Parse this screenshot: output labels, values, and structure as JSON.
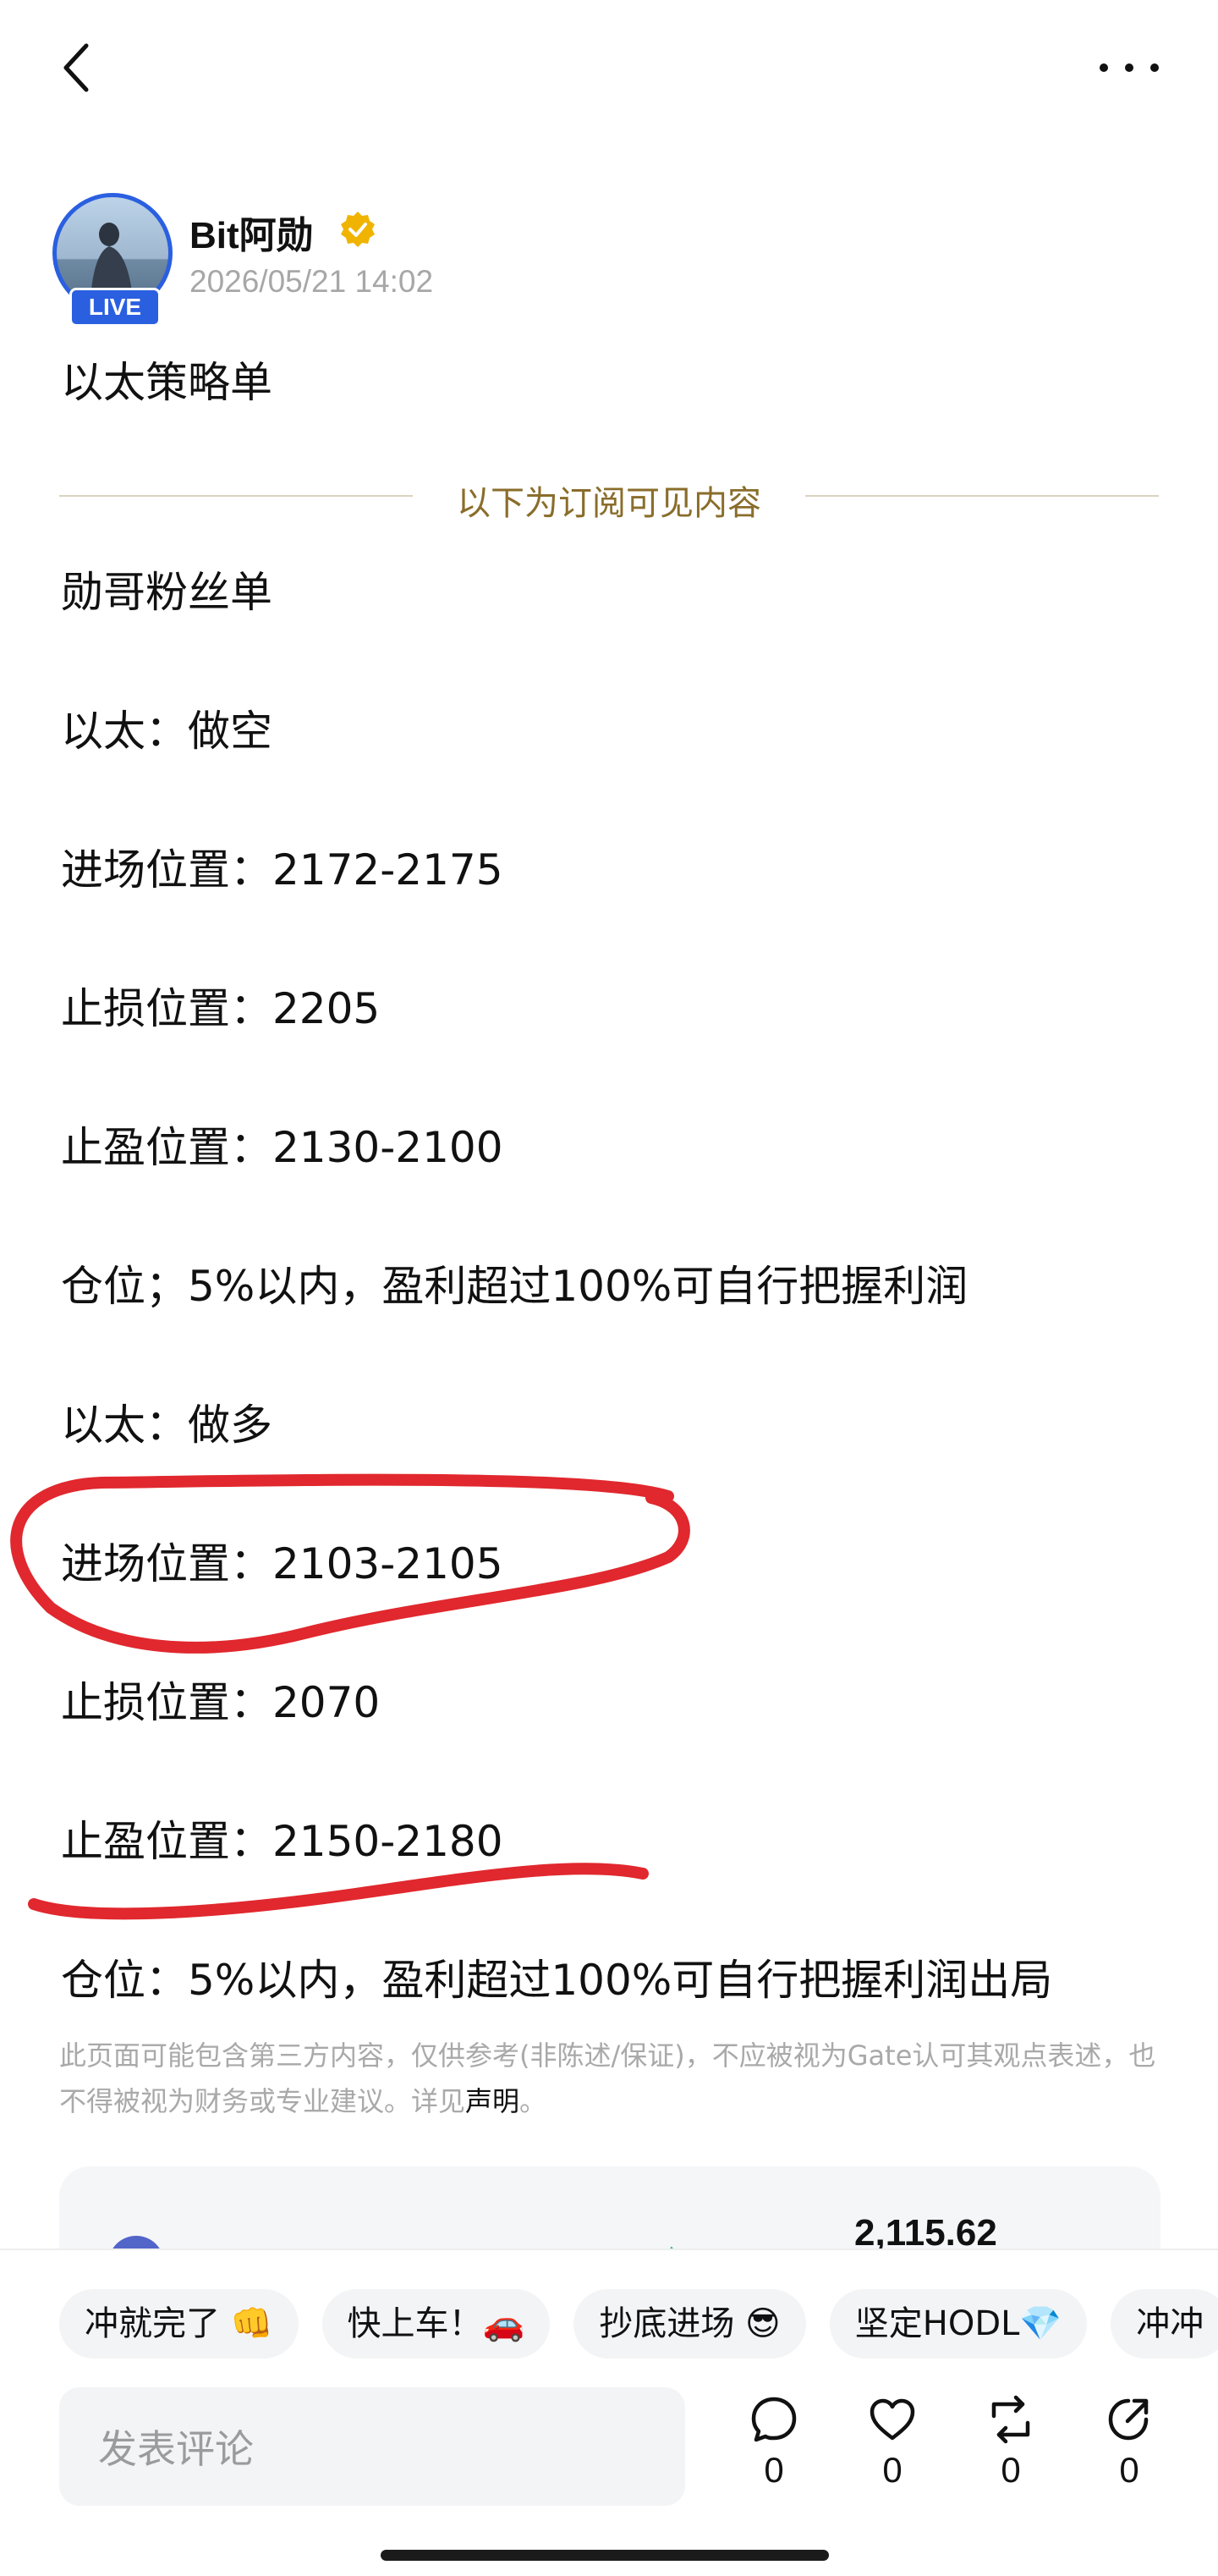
{
  "author": {
    "name": "Bit阿勋",
    "time": "2026/05/21 14:02",
    "live_badge": "LIVE"
  },
  "post": {
    "title": "以太策略单",
    "subscriber_divider": "以下为订阅可见内容",
    "lines": [
      "勋哥粉丝单",
      "以太：做空",
      "进场位置：2172-2175",
      "止损位置：2205",
      "止盈位置：2130-2100",
      "仓位；5%以内，盈利超过100%可自行把握利润",
      "以太：做多",
      "进场位置：2103-2105",
      "止损位置：2070",
      "止盈位置：2150-2180",
      "仓位：5%以内，盈利超过100%可自行把握利润出局"
    ],
    "disclaimer_text": "此页面可能包含第三方内容，仅供参考(非陈述/保证)，不应被视为Gate认可其观点表述，也不得被视为财务或专业建议。详见",
    "disclaimer_link": "声明",
    "disclaimer_end": "。"
  },
  "card": {
    "price": "2,115.62"
  },
  "reactions": [
    "冲就完了 👊",
    "快上车！🚗",
    "抄底进场 😎",
    "坚定HODL💎",
    "冲冲"
  ],
  "comment": {
    "placeholder": "发表评论"
  },
  "actions": {
    "comment_count": "0",
    "like_count": "0",
    "repost_count": "0",
    "share_count": "0"
  },
  "colors": {
    "brand_blue": "#2a5fe0",
    "divider_gold": "#8a6d2b",
    "annotation_red": "#e0282e",
    "verified_gold": "#f0b400"
  }
}
